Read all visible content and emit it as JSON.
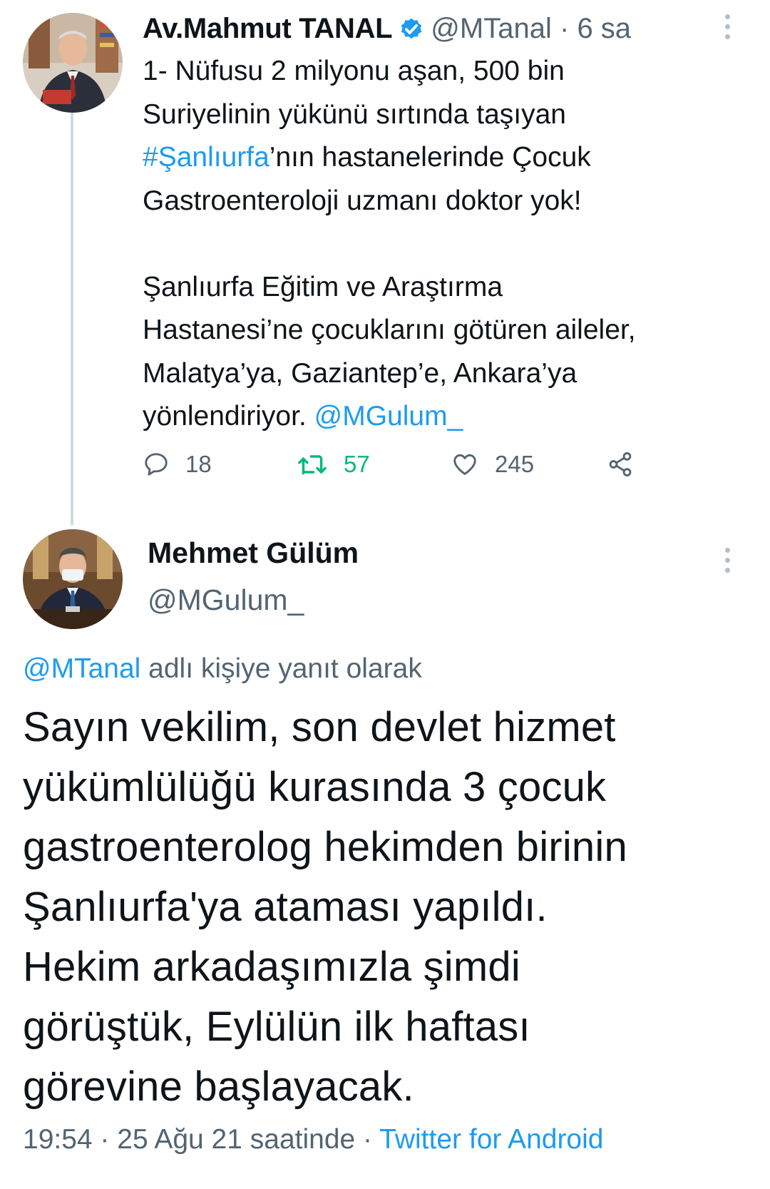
{
  "tweet1": {
    "author_name": "Av.Mahmut TANAL",
    "handle": "@MTanal",
    "separator": "·",
    "time": "6 sa",
    "body_lines": [
      "1- Nüfusu 2 milyonu aşan, 500 bin",
      "Suriyelinin yükünü sırtında taşıyan",
      "#Şanlıurfa",
      "’nın hastanelerinde Çocuk",
      "Gastroenteroloji uzmanı doktor yok!"
    ],
    "body2_lines": [
      "Şanlıurfa Eğitim ve Araştırma",
      "Hastanesi’ne çocuklarını götüren aileler,",
      "Malatya’ya, Gaziantep’e, Ankara’ya",
      "yönlendiriyor. ",
      "@MGulum_"
    ],
    "replies": "18",
    "retweets": "57",
    "likes": "245"
  },
  "tweet2": {
    "author_name": "Mehmet Gülüm",
    "handle": "@MGulum_",
    "reply_to_handle": "@MTanal",
    "reply_to_text": " adlı kişiye yanıt olarak",
    "body_lines": [
      "Sayın vekilim,  son devlet hizmet",
      "yükümlülüğü kurasında 3 çocuk",
      "gastroenterolog hekimden birinin",
      "Şanlıurfa'ya ataması yapıldı.",
      "Hekim arkadaşımızla şimdi",
      "görüştük, Eylülün ilk haftası",
      "görevine başlayacak."
    ],
    "timestamp": "19:54 · 25 Ağu 21 saatinde · ",
    "source": "Twitter for Android"
  },
  "icons": {
    "verified": "verified-badge-icon",
    "more": "more-vertical-icon",
    "reply": "reply-bubble-icon",
    "retweet": "retweet-icon",
    "like": "heart-icon",
    "share": "share-icon"
  },
  "colors": {
    "link": "#1d9bf0",
    "secondary_text": "#536471",
    "retweet_green": "#00ba7c",
    "thread_line": "#cfd9de"
  }
}
